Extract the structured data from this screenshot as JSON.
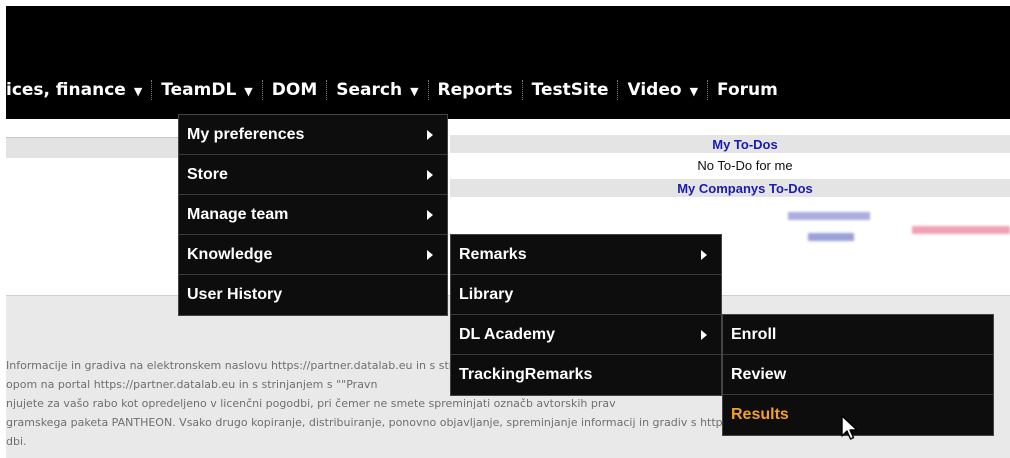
{
  "nav": {
    "items": [
      {
        "label": "ices, finance",
        "has_caret": true
      },
      {
        "label": "TeamDL",
        "has_caret": true
      },
      {
        "label": "DOM",
        "has_caret": false
      },
      {
        "label": "Search",
        "has_caret": true
      },
      {
        "label": "Reports",
        "has_caret": false
      },
      {
        "label": "TestSite",
        "has_caret": false
      },
      {
        "label": "Video",
        "has_caret": true
      },
      {
        "label": "Forum",
        "has_caret": false
      }
    ],
    "caret_glyph": "▼"
  },
  "menus": {
    "teamdl": [
      {
        "label": "My preferences",
        "submenu": true
      },
      {
        "label": "Store",
        "submenu": true
      },
      {
        "label": "Manage team",
        "submenu": true
      },
      {
        "label": "Knowledge",
        "submenu": true
      },
      {
        "label": "User History",
        "submenu": false
      }
    ],
    "knowledge": [
      {
        "label": "Remarks",
        "submenu": true
      },
      {
        "label": "Library",
        "submenu": false
      },
      {
        "label": "DL Academy",
        "submenu": true
      },
      {
        "label": "TrackingRemarks",
        "submenu": false
      }
    ],
    "dl_academy": [
      {
        "label": "Enroll",
        "submenu": false
      },
      {
        "label": "Review",
        "submenu": false
      },
      {
        "label": "Results",
        "submenu": false,
        "hovered": true
      }
    ]
  },
  "todos": {
    "my_title": "My To-Dos",
    "my_empty": "No To-Do for me",
    "company_title": "My Companys To-Dos"
  },
  "legal": {
    "lines": [
      "Informacije in gradiva na elektronskem naslovu https://partner.datalab.eu in s strinjanjem s \"\"Pravna d",
      "opom na portal https://partner.datalab.eu in s strinjanjem s \"\"Pravn",
      "njujete za vašo rabo kot opredeljeno v licenčni pogodbi, pri čemer ne smete spreminjati označb avtorskih prav",
      "gramskega paketa PANTHEON. Vsako drugo kopiranje, distribuiranje, ponovno objavljanje, spreminjanje informacij in gradiv s https://partner.datalab.e",
      "dbi."
    ]
  },
  "colors": {
    "topbar": "#000000",
    "menu_bg": "#0d0d0d",
    "todo_title": "#1a1ab5",
    "hover_accent": "#f2a026"
  }
}
